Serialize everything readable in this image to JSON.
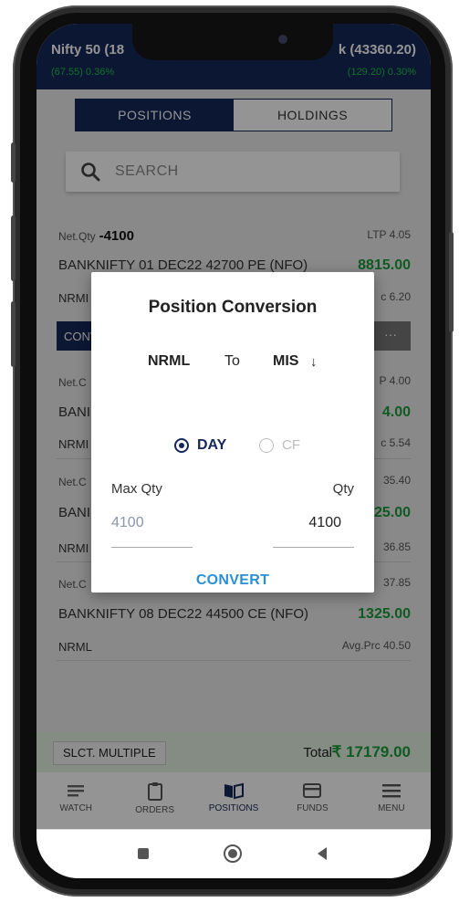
{
  "ticker": {
    "left_name": "Nifty 50 (18",
    "left_change": "(67.55) 0.36%",
    "right_name": "k (43360.20)",
    "right_change": "(129.20) 0.30%"
  },
  "tabs": [
    {
      "label": "POSITIONS",
      "active": true
    },
    {
      "label": "HOLDINGS",
      "active": false
    }
  ],
  "search": {
    "placeholder": "SEARCH",
    "icon": "search-icon"
  },
  "positions": {
    "r1": {
      "netqty_label": "Net.Qty",
      "netqty": "-4100",
      "ltp": "LTP 4.05",
      "name": "BANKNIFTY 01 DEC22 42700 PE  (NFO)",
      "pnl": "8815.00",
      "type": "NRMI",
      "avg": "c 6.20"
    },
    "conv_label": "CONV",
    "conv_more": "···",
    "r2": {
      "netqty": "Net.C",
      "ltp": "P 4.00",
      "name": "BANI",
      "pnl": "4.00",
      "type": "NRMI",
      "avg": "c 5.54"
    },
    "r3": {
      "netqty": "Net.C",
      "ltp": "35.40",
      "name": "BANI",
      "pnl": "25.00",
      "type": "NRMI",
      "avg": "36.85"
    },
    "r4": {
      "netqty": "Net.C",
      "ltp": "37.85",
      "name": "BANKNIFTY 08 DEC22 44500 CE  (NFO)",
      "pnl": "1325.00",
      "type": "NRML",
      "avg": "Avg.Prc 40.50"
    }
  },
  "dialog": {
    "title": "Position Conversion",
    "from": "NRML",
    "to": "To",
    "target": "MIS",
    "target_arrow": "↓",
    "options": [
      {
        "label": "DAY",
        "selected": true
      },
      {
        "label": "CF",
        "selected": false
      }
    ],
    "max_qty_label": "Max Qty",
    "max_qty_value": "4100",
    "qty_label": "Qty",
    "qty_value": "4100",
    "convert_label": "CONVERT"
  },
  "footer": {
    "select_multiple": "SLCT. MULTIPLE",
    "total_label": "Total",
    "total_value": "₹ 17179.00"
  },
  "nav": [
    {
      "label": "WATCH",
      "icon": "watch-icon"
    },
    {
      "label": "ORDERS",
      "icon": "orders-icon"
    },
    {
      "label": "POSITIONS",
      "icon": "positions-icon",
      "active": true
    },
    {
      "label": "FUNDS",
      "icon": "funds-icon"
    },
    {
      "label": "MENU",
      "icon": "menu-icon"
    }
  ],
  "system_nav": [
    "recents-icon",
    "home-icon",
    "back-icon"
  ],
  "colors": {
    "navy": "#15285a",
    "profit_green": "#1a9d3a",
    "accent_blue": "#2b8fd6"
  }
}
